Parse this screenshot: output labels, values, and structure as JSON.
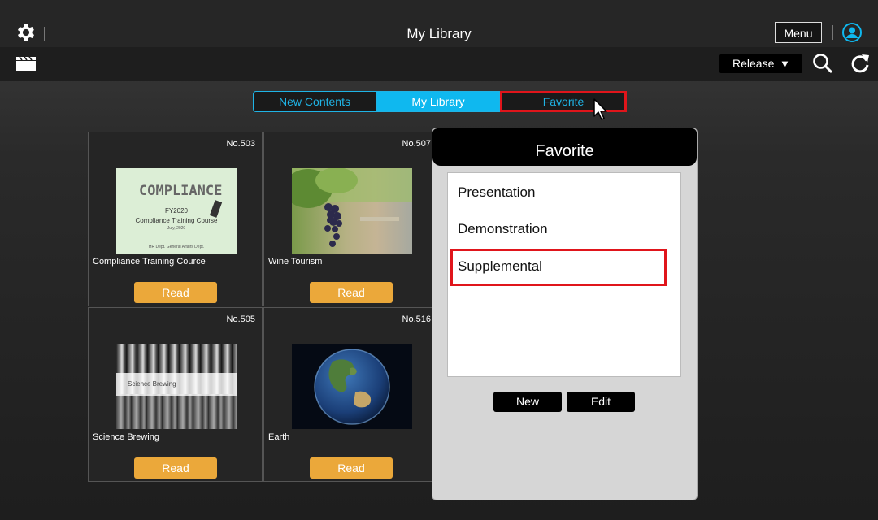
{
  "header": {
    "title": "My Library",
    "menu_label": "Menu",
    "release_label": "Release",
    "release_arrow": "▼"
  },
  "tabs": [
    {
      "label": "New Contents",
      "state": "normal"
    },
    {
      "label": "My Library",
      "state": "active"
    },
    {
      "label": "Favorite",
      "state": "highlighted"
    }
  ],
  "cards": [
    {
      "no": "No.503",
      "caption": "Compliance Training Cource",
      "read_label": "Read",
      "thumb": {
        "title": "COMPLIANCE",
        "line1": "FY2020",
        "line2": "Compliance Training Course",
        "line3": "July, 2020",
        "line4": "HR Dept. General Affairs Dept."
      }
    },
    {
      "no": "No.507",
      "caption": "Wine Tourism",
      "read_label": "Read",
      "thumb": {
        "overlay": ""
      }
    },
    {
      "no": "No.505",
      "caption": "Science Brewing",
      "read_label": "Read",
      "thumb": {
        "overlay": "Science Brewing"
      }
    },
    {
      "no": "No.516",
      "caption": "Earth",
      "read_label": "Read",
      "thumb": {}
    }
  ],
  "favorite_popup": {
    "title": "Favorite",
    "items": [
      "Presentation",
      "Demonstration",
      "Supplemental"
    ],
    "selected": "Supplemental",
    "new_label": "New",
    "edit_label": "Edit"
  },
  "colors": {
    "accent": "#0fb8ef",
    "read_button": "#eba83a",
    "highlight": "#e0151b"
  }
}
